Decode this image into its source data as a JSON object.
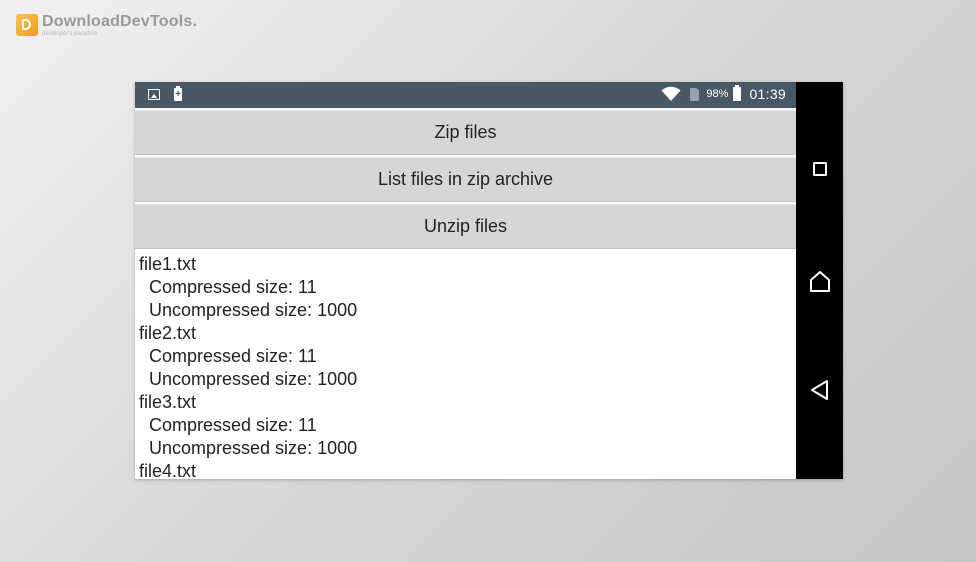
{
  "watermark": {
    "brand": "DownloadDevTools.",
    "tagline": "developer's paradise"
  },
  "status_bar": {
    "left_icons": [
      "image-notification-icon",
      "battery-charging-icon"
    ],
    "right_icons": [
      "wifi-icon",
      "sim-icon",
      "battery-icon"
    ],
    "battery_percent": "98%",
    "time": "01:39"
  },
  "buttons": {
    "zip": "Zip files",
    "list": "List files in zip archive",
    "unzip": "Unzip files"
  },
  "output": {
    "entries": [
      {
        "name": "file1.txt",
        "compressed": "Compressed size: 11",
        "uncompressed": "Uncompressed size: 1000"
      },
      {
        "name": "file2.txt",
        "compressed": "Compressed size: 11",
        "uncompressed": "Uncompressed size: 1000"
      },
      {
        "name": "file3.txt",
        "compressed": "Compressed size: 11",
        "uncompressed": "Uncompressed size: 1000"
      },
      {
        "name": "file4.txt"
      }
    ]
  },
  "navigation_bar": {
    "icons": [
      "recents-square-icon",
      "home-icon",
      "back-icon"
    ]
  },
  "colors": {
    "status_bar": "#4a5866",
    "button_bg": "#d6d6d6",
    "nav_bar": "#000000"
  }
}
